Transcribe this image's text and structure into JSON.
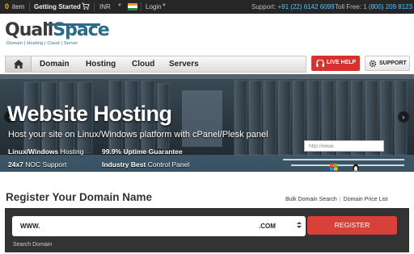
{
  "topbar": {
    "cart_count": "0",
    "cart_label": "item",
    "getting_started": "Getting Started",
    "currency": "INR",
    "login": "Login",
    "support_label": "Support:",
    "support_phone": "+91 (22) 6142 6099",
    "tollfree_label": "Toll Free:",
    "tollfree_phone": "1 (800) 209 8123",
    "icons": [
      "cart-icon",
      "india-flag-icon",
      "caret-down-icon"
    ]
  },
  "logo": {
    "name_part1": "Quali",
    "name_part2": "Space",
    "tagline": "Domain | Hosting | Cloud | Server"
  },
  "nav": {
    "items": [
      "Domain",
      "Hosting",
      "Cloud",
      "Servers"
    ],
    "home_icon": "home-icon"
  },
  "help_button": {
    "label": "LIVE HELP",
    "icon": "headset-icon",
    "color": "#d8322f"
  },
  "support_button": {
    "label": "SUPPORT",
    "icon": "gear-icon"
  },
  "banner": {
    "title": "Website Hosting",
    "subtitle": "Host your site on Linux/Windows platform with cPanel/Plesk panel",
    "features": [
      {
        "bold": "Linux/Windows",
        "rest": " Hosting"
      },
      {
        "bold": "99.9% Uptime Guarantee",
        "rest": ""
      },
      {
        "bold": "24x7",
        "rest": " NOC Support"
      },
      {
        "bold": "Industry Best",
        "rest": " Control Panel"
      }
    ],
    "url_placeholder": "http://www.",
    "prev_icon": "chevron-left-icon",
    "next_icon": "chevron-right-icon"
  },
  "register": {
    "title": "Register Your Domain Name",
    "link_bulk": "Bulk Domain Search",
    "link_price": "Domain Price List",
    "prefix": "WWW.",
    "tld": ".COM",
    "button": "REGISTER",
    "hint": "Search Domain",
    "accent": "#d8403a"
  }
}
